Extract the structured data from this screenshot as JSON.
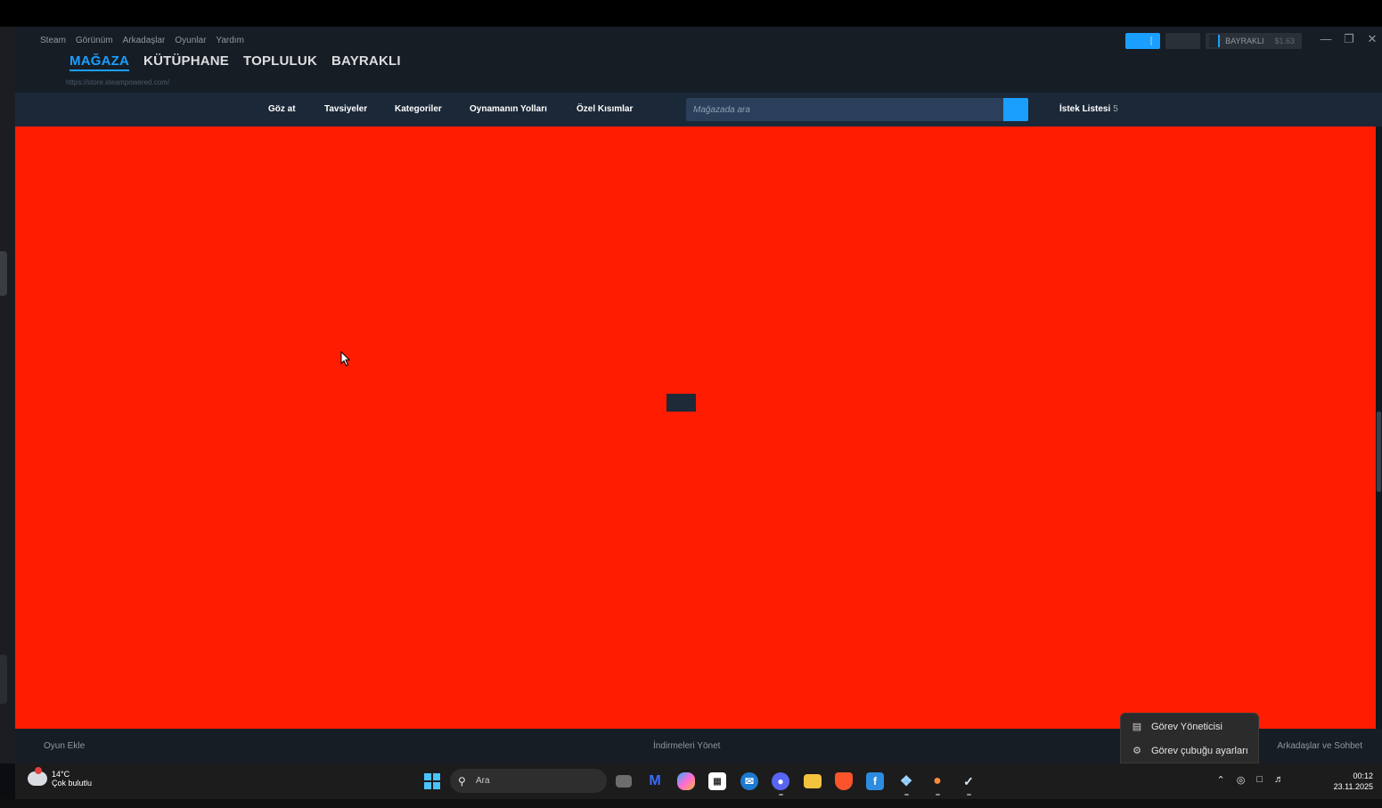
{
  "steam_window": {
    "menu": [
      "Steam",
      "Görünüm",
      "Arkadaşlar",
      "Oyunlar",
      "Yardım"
    ],
    "tabs": [
      "MAĞAZA",
      "KÜTÜPHANE",
      "TOPLULUK",
      "BAYRAKLI"
    ],
    "active_tab": "MAĞAZA",
    "url": "https://store.steampowered.com/",
    "account": {
      "name": "BAYRAKLI",
      "balance": "$1.63"
    },
    "accent_color": "#1a9fff"
  },
  "store_nav": {
    "items": [
      "Göz at",
      "Tavsiyeler",
      "Kategoriler",
      "Oynamanın Yolları",
      "Özel Kısımlar"
    ],
    "search_placeholder": "Mağazada ara",
    "wishlist_label": "İstek Listesi",
    "wishlist_count": "5"
  },
  "content": {
    "background_color": "#ff1c00"
  },
  "bottom_bar": {
    "add_game": "Oyun Ekle",
    "manage_downloads": "İndirmeleri Yönet",
    "friends_chat": "Arkadaşlar ve Sohbet"
  },
  "context_menu": {
    "items": [
      {
        "label": "Görev Yöneticisi",
        "icon": "task-manager-icon"
      },
      {
        "label": "Görev çubuğu ayarları",
        "icon": "gear-icon"
      }
    ]
  },
  "taskbar": {
    "weather_temp": "14°C",
    "weather_desc": "Çok bulutlu",
    "search_placeholder": "Ara",
    "time": "00:12",
    "date": "23.11.2025",
    "apps": [
      "task-view-icon",
      "malwarebytes-icon",
      "copilot-icon",
      "microsoft-store-icon",
      "mail-icon",
      "discord-icon",
      "file-explorer-icon",
      "brave-icon",
      "app-f-icon",
      "settings-app-icon",
      "microphone-app-icon",
      "steam-icon"
    ]
  }
}
